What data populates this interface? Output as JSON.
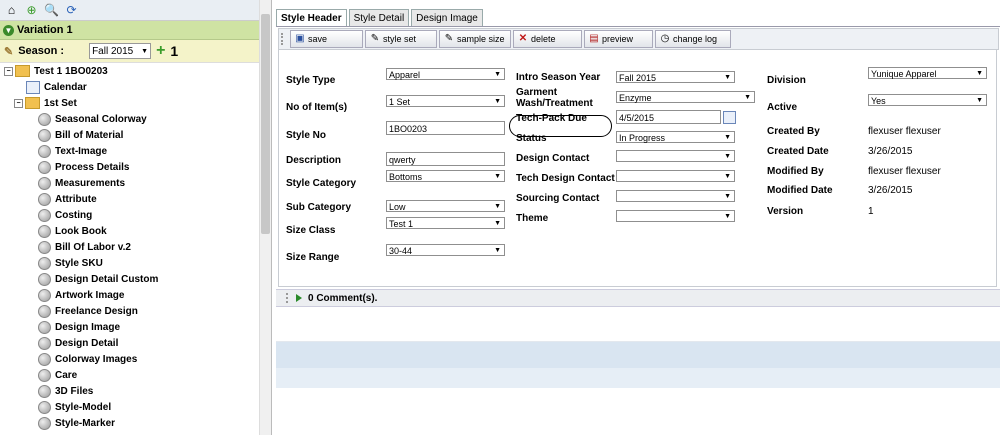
{
  "variation": "Variation 1",
  "season": {
    "label": "Season :",
    "value": "Fall 2015",
    "count": "1"
  },
  "tree": {
    "root": "Test 1    1BO0203",
    "calendar": "Calendar",
    "set": "1st Set",
    "items": [
      "Seasonal Colorway",
      "Bill of Material",
      "Text-Image",
      "Process Details",
      "Measurements",
      "Attribute",
      "Costing",
      "Look Book",
      "Bill Of Labor v.2",
      "Style SKU",
      "Design Detail Custom",
      "Artwork Image",
      "Freelance Design",
      "Design Image",
      "Design Detail",
      "Colorway Images",
      "Care",
      "3D Files",
      "Style-Model",
      "Style-Marker"
    ]
  },
  "tabs": [
    "Style Header",
    "Style Detail",
    "Design Image"
  ],
  "actions": [
    "save",
    "style set",
    "sample size",
    "delete",
    "preview",
    "change log"
  ],
  "col1": {
    "style_type": {
      "label": "Style Type",
      "value": "Apparel"
    },
    "no_items": {
      "label": "No of Item(s)",
      "value": "1 Set"
    },
    "style_no": {
      "label": "Style No",
      "value": "1BO0203"
    },
    "description": {
      "label": "Description",
      "value": "qwerty"
    },
    "style_category": {
      "label": "Style Category",
      "value": "Bottoms"
    },
    "sub_category": {
      "label": "Sub Category",
      "value": "Low"
    },
    "size_class": {
      "label": "Size Class",
      "value": "Test 1"
    },
    "size_range": {
      "label": "Size Range",
      "value": "30-44"
    }
  },
  "col2": {
    "intro_season": {
      "label": "Intro Season Year",
      "value": "Fall 2015"
    },
    "garment_wash": {
      "label": "Garment Wash/Treatment",
      "value": "Enzyme"
    },
    "techpack_due": {
      "label": "Tech-Pack Due",
      "value": "4/5/2015"
    },
    "status": {
      "label": "Status",
      "value": "In Progress"
    },
    "design_contact": {
      "label": "Design Contact",
      "value": ""
    },
    "tech_design_contact": {
      "label": "Tech Design Contact",
      "value": ""
    },
    "sourcing_contact": {
      "label": "Sourcing Contact",
      "value": ""
    },
    "theme": {
      "label": "Theme",
      "value": ""
    }
  },
  "col3": {
    "division": {
      "label": "Division",
      "value": "Yunique Apparel"
    },
    "active": {
      "label": "Active",
      "value": "Yes"
    },
    "created_by": {
      "label": "Created By",
      "value": "flexuser flexuser"
    },
    "created_date": {
      "label": "Created Date",
      "value": "3/26/2015"
    },
    "modified_by": {
      "label": "Modified By",
      "value": "flexuser flexuser"
    },
    "modified_date": {
      "label": "Modified Date",
      "value": "3/26/2015"
    },
    "version": {
      "label": "Version",
      "value": "1"
    }
  },
  "comments": "0 Comment(s)."
}
